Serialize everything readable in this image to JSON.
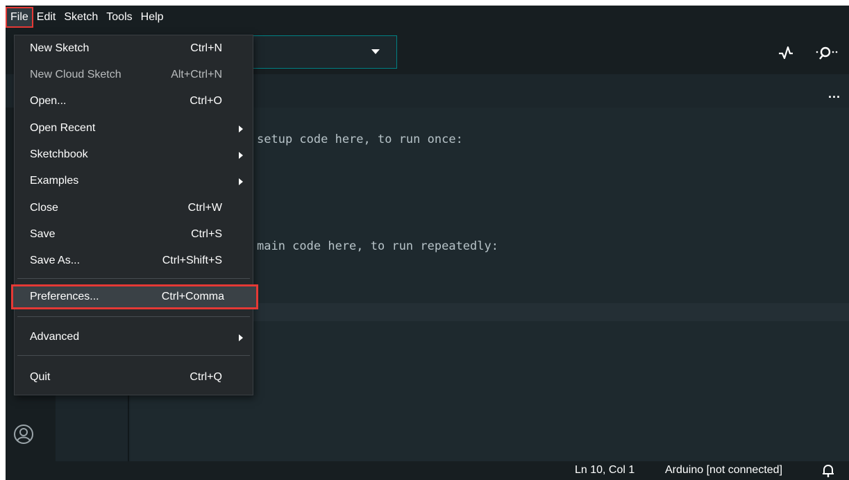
{
  "menubar": {
    "items": [
      {
        "label": "File"
      },
      {
        "label": "Edit"
      },
      {
        "label": "Sketch"
      },
      {
        "label": "Tools"
      },
      {
        "label": "Help"
      }
    ]
  },
  "file_menu": {
    "items": [
      {
        "label": "New Sketch",
        "shortcut": "Ctrl+N"
      },
      {
        "label": "New Cloud Sketch",
        "shortcut": "Alt+Ctrl+N",
        "disabled": true
      },
      {
        "label": "Open...",
        "shortcut": "Ctrl+O"
      },
      {
        "label": "Open Recent",
        "submenu": true
      },
      {
        "label": "Sketchbook",
        "submenu": true
      },
      {
        "label": "Examples",
        "submenu": true
      },
      {
        "label": "Close",
        "shortcut": "Ctrl+W"
      },
      {
        "label": "Save",
        "shortcut": "Ctrl+S"
      },
      {
        "label": "Save As...",
        "shortcut": "Ctrl+Shift+S"
      },
      {
        "label": "Preferences...",
        "shortcut": "Ctrl+Comma",
        "highlighted": true
      },
      {
        "label": "Advanced",
        "submenu": true
      },
      {
        "label": "Quit",
        "shortcut": "Ctrl+Q"
      }
    ]
  },
  "editor": {
    "lines": [
      "setup code here, to run once:",
      "main code here, to run repeatedly:"
    ]
  },
  "tabbar": {
    "more": "..."
  },
  "statusbar": {
    "cursor_position": "Ln 10, Col 1",
    "board": "Arduino [not connected]"
  },
  "colors": {
    "accent": "#008184",
    "highlight_border": "#e53935",
    "menu_bg": "#25292c",
    "app_bg": "#1c262b"
  }
}
